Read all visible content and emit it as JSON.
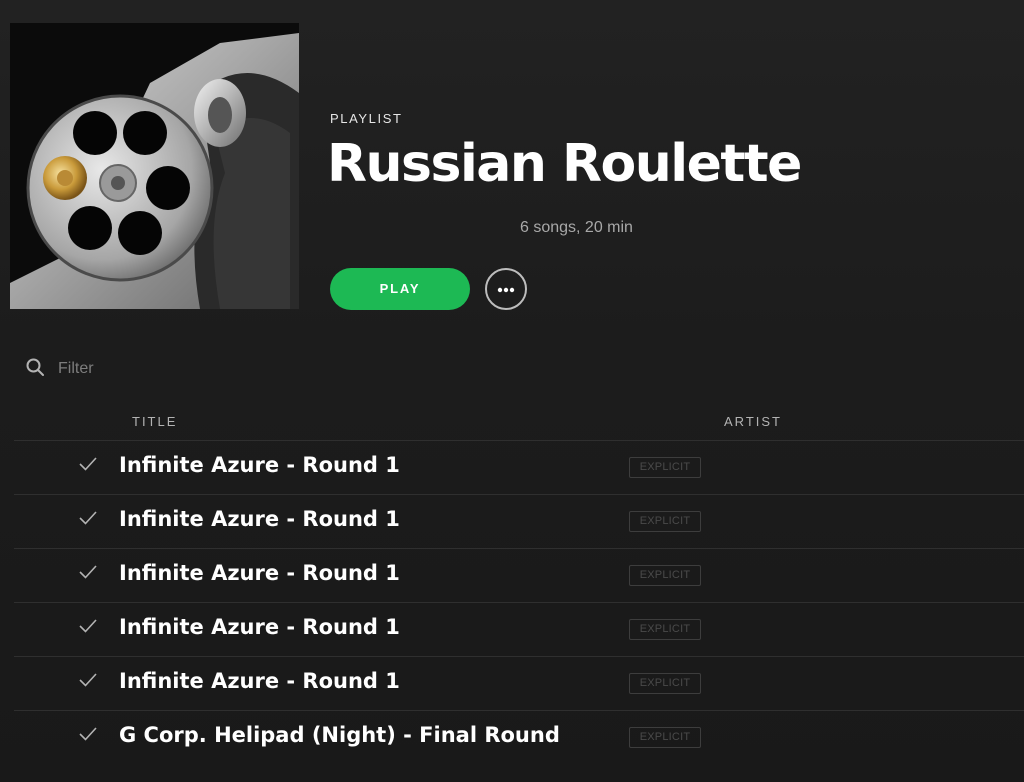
{
  "header": {
    "type_label": "PLAYLIST",
    "title": "Russian Roulette",
    "meta": "6 songs, 20 min",
    "cover_icon": "revolver-cylinder-image"
  },
  "actions": {
    "play_label": "PLAY",
    "more_icon": "more-dots-icon"
  },
  "filter": {
    "icon": "search-icon",
    "placeholder": "Filter",
    "value": ""
  },
  "table": {
    "columns": {
      "title": "TITLE",
      "artist": "ARTIST"
    },
    "rows": [
      {
        "title": "Infinite Azure - Round 1",
        "explicit": "EXPLICIT",
        "saved": true,
        "artist": ""
      },
      {
        "title": "Infinite Azure - Round 1",
        "explicit": "EXPLICIT",
        "saved": true,
        "artist": ""
      },
      {
        "title": "Infinite Azure - Round 1",
        "explicit": "EXPLICIT",
        "saved": true,
        "artist": ""
      },
      {
        "title": "Infinite Azure - Round 1",
        "explicit": "EXPLICIT",
        "saved": true,
        "artist": ""
      },
      {
        "title": "Infinite Azure - Round 1",
        "explicit": "EXPLICIT",
        "saved": true,
        "artist": ""
      },
      {
        "title": "G Corp. Helipad (Night) - Final Round",
        "explicit": "EXPLICIT",
        "saved": true,
        "artist": ""
      }
    ]
  },
  "colors": {
    "accent": "#1db954",
    "background": "#1c1c1c",
    "text": "#ffffff",
    "muted": "#b3b3b3"
  }
}
